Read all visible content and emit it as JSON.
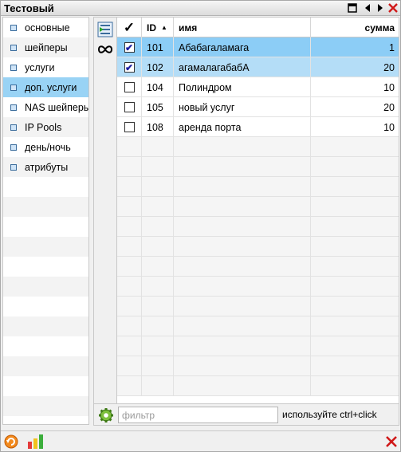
{
  "window": {
    "title": "Тестовый"
  },
  "sidebar": {
    "items": [
      {
        "label": "основные"
      },
      {
        "label": "шейперы"
      },
      {
        "label": "услуги"
      },
      {
        "label": "доп. услуги",
        "selected": true
      },
      {
        "label": "NAS шейперы"
      },
      {
        "label": "IP Pools"
      },
      {
        "label": "день/ночь"
      },
      {
        "label": "атрибуты"
      }
    ]
  },
  "grid": {
    "columns": {
      "check": "✓",
      "id": "ID",
      "name": "имя",
      "sum": "сумма"
    },
    "sort_indicator": "▲",
    "rows": [
      {
        "checked": true,
        "id": "101",
        "name": "Абабагаламага",
        "sum": "1"
      },
      {
        "checked": true,
        "id": "102",
        "name": "агамалагабабА",
        "sum": "20"
      },
      {
        "checked": false,
        "id": "104",
        "name": "Полиндром",
        "sum": "10"
      },
      {
        "checked": false,
        "id": "105",
        "name": "новый услуг",
        "sum": "20"
      },
      {
        "checked": false,
        "id": "108",
        "name": "аренда порта",
        "sum": "10"
      }
    ]
  },
  "filter": {
    "placeholder": "фильтр",
    "value": ""
  },
  "hint": {
    "text": "используйте ctrl+click"
  },
  "colors": {
    "selected": "#99d3f5",
    "row_selected": "#8ccdf6",
    "close": "#e02020"
  },
  "icons": [
    "restore-window-icon",
    "arrow-left-icon",
    "arrow-right-icon",
    "close-icon",
    "edit-list-icon",
    "infinity-icon",
    "gear-icon",
    "refresh-icon",
    "bar-chart-icon"
  ]
}
